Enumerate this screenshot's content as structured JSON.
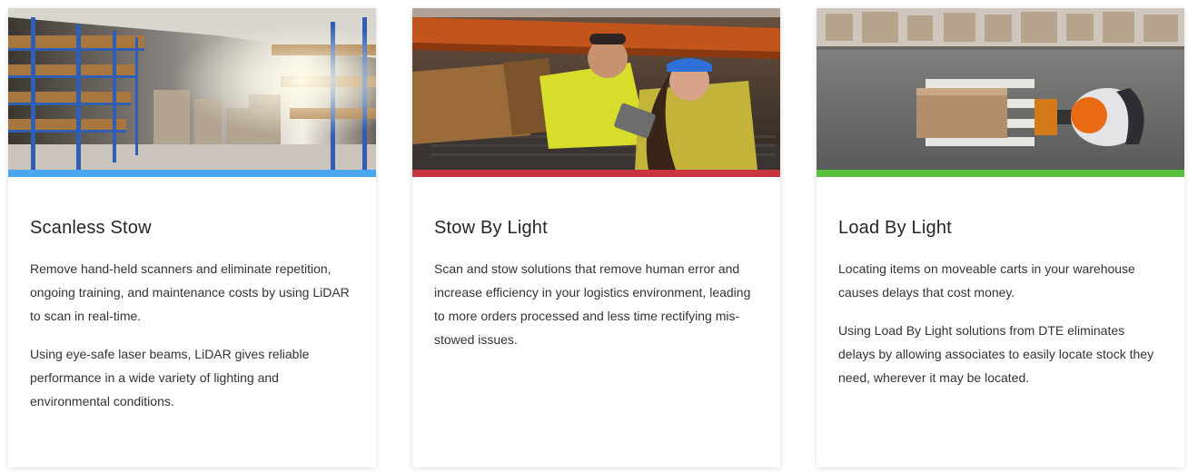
{
  "accent_colors": {
    "blue": "#4ba8f0",
    "red": "#c8343f",
    "green": "#5bbf3e"
  },
  "cards": [
    {
      "image": "warehouse-shelves-photo",
      "accent": "#4ba8f0",
      "title": "Scanless Stow",
      "paragraphs": [
        "Remove hand-held scanners and eliminate repetition, ongoing training, and maintenance costs by using LiDAR to scan in real-time.",
        "Using eye-safe laser beams, LiDAR gives reliable performance in a wide variety of lighting and environmental conditions."
      ]
    },
    {
      "image": "workers-with-tablet-photo",
      "accent": "#c8343f",
      "title": "Stow By Light",
      "paragraphs": [
        "Scan and stow solutions that remove human error and increase efficiency in your logistics environment, leading to more orders processed and less time rectifying mis-stowed issues."
      ]
    },
    {
      "image": "pallet-jack-overhead-photo",
      "accent": "#5bbf3e",
      "title": "Load By Light",
      "paragraphs": [
        "Locating items on moveable carts in your warehouse causes delays that cost money.",
        "Using Load By Light solutions from DTE eliminates delays by allowing associates to easily locate stock they need, wherever it may be located."
      ]
    }
  ]
}
